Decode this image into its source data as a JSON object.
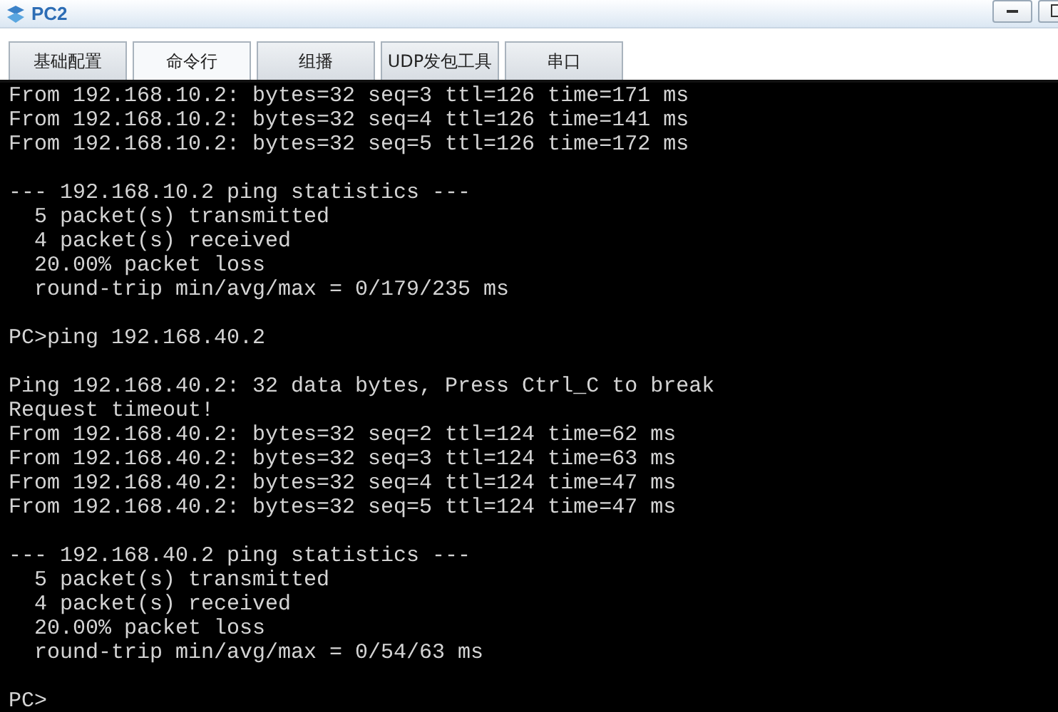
{
  "window": {
    "title": "PC2"
  },
  "tabs": [
    {
      "label": "基础配置",
      "selected": false
    },
    {
      "label": "命令行",
      "selected": true
    },
    {
      "label": "组播",
      "selected": false
    },
    {
      "label": "UDP发包工具",
      "selected": false
    },
    {
      "label": "串口",
      "selected": false
    }
  ],
  "terminal": {
    "lines": [
      {
        "kind": "text",
        "text": "From 192.168.10.2: bytes=32 seq=3 ttl=126 time=171 ms"
      },
      {
        "kind": "text",
        "text": "From 192.168.10.2: bytes=32 seq=4 ttl=126 time=141 ms"
      },
      {
        "kind": "text",
        "text": "From 192.168.10.2: bytes=32 seq=5 ttl=126 time=172 ms"
      },
      {
        "kind": "blank"
      },
      {
        "kind": "text",
        "text": "--- 192.168.10.2 ping statistics ---"
      },
      {
        "kind": "text",
        "text": "  5 packet(s) transmitted"
      },
      {
        "kind": "text",
        "text": "  4 packet(s) received"
      },
      {
        "kind": "text",
        "text": "  20.00% packet loss"
      },
      {
        "kind": "text",
        "text": "  round-trip min/avg/max = 0/179/235 ms"
      },
      {
        "kind": "blank"
      },
      {
        "kind": "text",
        "text": "PC>ping 192.168.40.2"
      },
      {
        "kind": "blank"
      },
      {
        "kind": "text",
        "text": "Ping 192.168.40.2: 32 data bytes, Press Ctrl_C to break"
      },
      {
        "kind": "text",
        "text": "Request timeout!"
      },
      {
        "kind": "text",
        "text": "From 192.168.40.2: bytes=32 seq=2 ttl=124 time=62 ms"
      },
      {
        "kind": "text",
        "text": "From 192.168.40.2: bytes=32 seq=3 ttl=124 time=63 ms"
      },
      {
        "kind": "text",
        "text": "From 192.168.40.2: bytes=32 seq=4 ttl=124 time=47 ms"
      },
      {
        "kind": "text",
        "text": "From 192.168.40.2: bytes=32 seq=5 ttl=124 time=47 ms"
      },
      {
        "kind": "blank"
      },
      {
        "kind": "text",
        "text": "--- 192.168.40.2 ping statistics ---"
      },
      {
        "kind": "text",
        "text": "  5 packet(s) transmitted"
      },
      {
        "kind": "text",
        "text": "  4 packet(s) received"
      },
      {
        "kind": "text",
        "text": "  20.00% packet loss"
      },
      {
        "kind": "text",
        "text": "  round-trip min/avg/max = 0/54/63 ms"
      },
      {
        "kind": "blank"
      },
      {
        "kind": "text",
        "text": "PC>"
      }
    ]
  }
}
